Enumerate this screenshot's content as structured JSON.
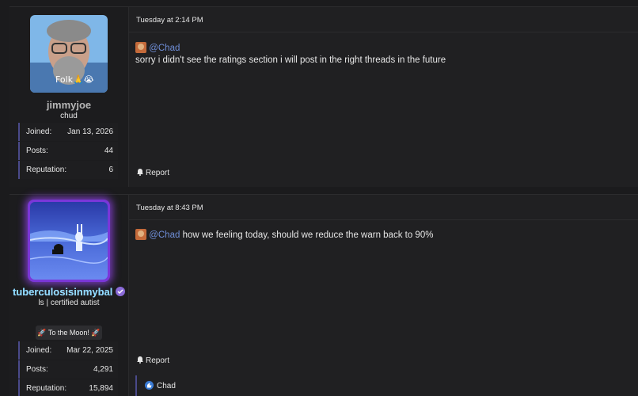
{
  "posts": [
    {
      "username": "jimmyjoe",
      "user_title": "chud",
      "avatar_text": "Folk🙏😭",
      "stats": [
        {
          "label": "Joined:",
          "value": "Jan 13, 2026"
        },
        {
          "label": "Posts:",
          "value": "44"
        },
        {
          "label": "Reputation:",
          "value": "6"
        }
      ],
      "date": "Tuesday at 2:14 PM",
      "mention": "@Chad",
      "message": "sorry i didn't see the ratings section i will post in the right threads in the future",
      "report_label": "Report"
    },
    {
      "username": "tuberculosisinmybal",
      "username_colors": [
        "#6ad0ff",
        "#ffffff"
      ],
      "user_title": "ls | certified autist",
      "banner": "🚀 To the Moon! 🚀",
      "stats": [
        {
          "label": "Joined:",
          "value": "Mar 22, 2025"
        },
        {
          "label": "Posts:",
          "value": "4,291"
        },
        {
          "label": "Reputation:",
          "value": "15,894"
        }
      ],
      "date": "Tuesday at 8:43 PM",
      "mention": "@Chad",
      "message": "how we feeling today, should we reduce the warn back to 90%",
      "report_label": "Report",
      "reaction_user": "Chad"
    }
  ],
  "colors": {
    "mention": "#6f8ed8",
    "verified_badge": "#8a6ad8",
    "avatar_glow": "#7a37d8"
  }
}
